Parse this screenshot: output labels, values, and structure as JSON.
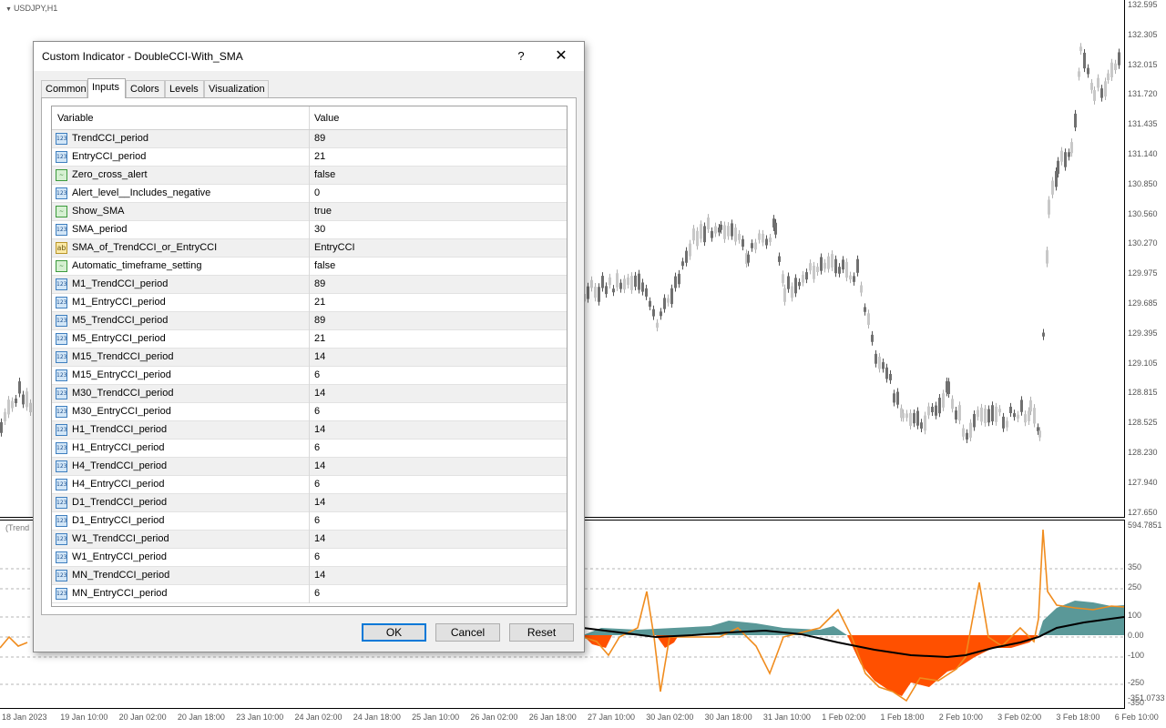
{
  "chart": {
    "symbol": "USDJPY,H1",
    "indicator_label": "(Trend",
    "price_axis": [
      "132.595",
      "132.305",
      "132.015",
      "131.720",
      "131.435",
      "131.140",
      "130.850",
      "130.560",
      "130.270",
      "129.975",
      "129.685",
      "129.395",
      "129.105",
      "128.815",
      "128.525",
      "128.230",
      "127.940",
      "127.650"
    ],
    "indicator_axis": [
      "594.7851",
      "350",
      "250",
      "100",
      "0.00",
      "-100",
      "-250",
      "-350",
      "-351.0733"
    ],
    "time_axis": [
      "18 Jan 2023",
      "19 Jan 10:00",
      "20 Jan 02:00",
      "20 Jan 18:00",
      "23 Jan 10:00",
      "24 Jan 02:00",
      "24 Jan 18:00",
      "25 Jan 10:00",
      "26 Jan 02:00",
      "26 Jan 18:00",
      "27 Jan 10:00",
      "30 Jan 02:00",
      "30 Jan 18:00",
      "31 Jan 10:00",
      "1 Feb 02:00",
      "1 Feb 18:00",
      "2 Feb 10:00",
      "3 Feb 02:00",
      "3 Feb 18:00",
      "6 Feb 10:00"
    ],
    "colors": {
      "bull_candle": "#c8c8c8",
      "bear_candle": "#707070",
      "trend_positive": "#5a9898",
      "trend_negative": "#ff5000",
      "entry_cci_line": "#f08c1e",
      "sma_line": "#000000"
    }
  },
  "dialog": {
    "title": "Custom Indicator - DoubleCCI-With_SMA",
    "help_label": "?",
    "close_label": "✕",
    "tabs": [
      "Common",
      "Inputs",
      "Colors",
      "Levels",
      "Visualization"
    ],
    "active_tab": "Inputs",
    "columns": {
      "variable": "Variable",
      "value": "Value"
    },
    "rows": [
      {
        "type": "int",
        "name": "TrendCCI_period",
        "value": "89"
      },
      {
        "type": "int",
        "name": "EntryCCI_period",
        "value": "21"
      },
      {
        "type": "bool",
        "name": "Zero_cross_alert",
        "value": "false"
      },
      {
        "type": "int",
        "name": "Alert_level__Includes_negative",
        "value": "0"
      },
      {
        "type": "bool",
        "name": "Show_SMA",
        "value": "true"
      },
      {
        "type": "int",
        "name": "SMA_period",
        "value": "30"
      },
      {
        "type": "str",
        "name": "SMA_of_TrendCCI_or_EntryCCI",
        "value": "EntryCCI"
      },
      {
        "type": "bool",
        "name": "Automatic_timeframe_setting",
        "value": "false"
      },
      {
        "type": "int",
        "name": "M1_TrendCCI_period",
        "value": "89"
      },
      {
        "type": "int",
        "name": "M1_EntryCCI_period",
        "value": "21"
      },
      {
        "type": "int",
        "name": "M5_TrendCCI_period",
        "value": "89"
      },
      {
        "type": "int",
        "name": "M5_EntryCCI_period",
        "value": "21"
      },
      {
        "type": "int",
        "name": "M15_TrendCCI_period",
        "value": "14"
      },
      {
        "type": "int",
        "name": "M15_EntryCCI_period",
        "value": "6"
      },
      {
        "type": "int",
        "name": "M30_TrendCCI_period",
        "value": "14"
      },
      {
        "type": "int",
        "name": "M30_EntryCCI_period",
        "value": "6"
      },
      {
        "type": "int",
        "name": "H1_TrendCCI_period",
        "value": "14"
      },
      {
        "type": "int",
        "name": "H1_EntryCCI_period",
        "value": "6"
      },
      {
        "type": "int",
        "name": "H4_TrendCCI_period",
        "value": "14"
      },
      {
        "type": "int",
        "name": "H4_EntryCCI_period",
        "value": "6"
      },
      {
        "type": "int",
        "name": "D1_TrendCCI_period",
        "value": "14"
      },
      {
        "type": "int",
        "name": "D1_EntryCCI_period",
        "value": "6"
      },
      {
        "type": "int",
        "name": "W1_TrendCCI_period",
        "value": "14"
      },
      {
        "type": "int",
        "name": "W1_EntryCCI_period",
        "value": "6"
      },
      {
        "type": "int",
        "name": "MN_TrendCCI_period",
        "value": "14"
      },
      {
        "type": "int",
        "name": "MN_EntryCCI_period",
        "value": "6"
      }
    ],
    "icon_text": {
      "int": "123",
      "bool": "~",
      "str": "ab"
    },
    "buttons": {
      "ok": "OK",
      "cancel": "Cancel",
      "reset": "Reset"
    }
  }
}
